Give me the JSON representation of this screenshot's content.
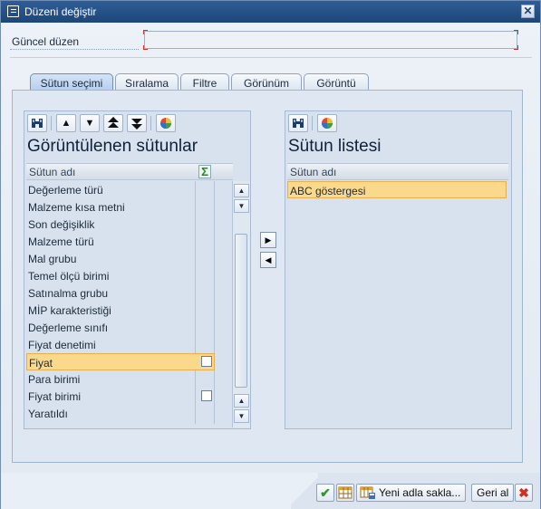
{
  "window": {
    "title": "Düzeni değiştir",
    "close_glyph": "✕",
    "title_icon": "edit-layout-icon"
  },
  "layout": {
    "label": "Güncel düzen",
    "value": "",
    "placeholder": ""
  },
  "tabs": [
    {
      "label": "Sütun seçimi",
      "active": true
    },
    {
      "label": "Sıralama",
      "active": false
    },
    {
      "label": "Filtre",
      "active": false
    },
    {
      "label": "Görünüm",
      "active": false
    },
    {
      "label": "Görüntü",
      "active": false
    }
  ],
  "left": {
    "heading": "Görüntülenen sütunlar",
    "column_header": "Sütun adı",
    "sum_icon": "Σ",
    "rows": [
      {
        "label": "Değerleme türü",
        "selected": false,
        "checkbox": false
      },
      {
        "label": "Malzeme kısa metni",
        "selected": false,
        "checkbox": false
      },
      {
        "label": "Son değişiklik",
        "selected": false,
        "checkbox": false
      },
      {
        "label": "Malzeme türü",
        "selected": false,
        "checkbox": false
      },
      {
        "label": "Mal grubu",
        "selected": false,
        "checkbox": false
      },
      {
        "label": "Temel ölçü birimi",
        "selected": false,
        "checkbox": false
      },
      {
        "label": "Satınalma grubu",
        "selected": false,
        "checkbox": false
      },
      {
        "label": "MİP karakteristiği",
        "selected": false,
        "checkbox": false
      },
      {
        "label": "Değerleme sınıfı",
        "selected": false,
        "checkbox": false
      },
      {
        "label": "Fiyat denetimi",
        "selected": false,
        "checkbox": false
      },
      {
        "label": "Fiyat",
        "selected": true,
        "checkbox": true
      },
      {
        "label": "Para birimi",
        "selected": false,
        "checkbox": false
      },
      {
        "label": "Fiyat birimi",
        "selected": false,
        "checkbox": true
      },
      {
        "label": "Yaratıldı",
        "selected": false,
        "checkbox": false
      }
    ],
    "toolbar_icons": [
      "find-icon",
      "move-up-icon",
      "move-down-icon",
      "move-top-icon",
      "move-bottom-icon",
      "color-wheel-icon"
    ]
  },
  "right": {
    "heading": "Sütun listesi",
    "column_header": "Sütun adı",
    "rows": [
      {
        "label": "ABC göstergesi",
        "selected": true
      }
    ],
    "toolbar_icons": [
      "find-icon",
      "color-wheel-icon"
    ]
  },
  "move": {
    "right_glyph": "▶",
    "left_glyph": "◀"
  },
  "footer": {
    "save_as_label": "Yeni adla sakla...",
    "undo_label": "Geri al",
    "confirm_glyph": "✔",
    "cancel_glyph": "✖"
  }
}
